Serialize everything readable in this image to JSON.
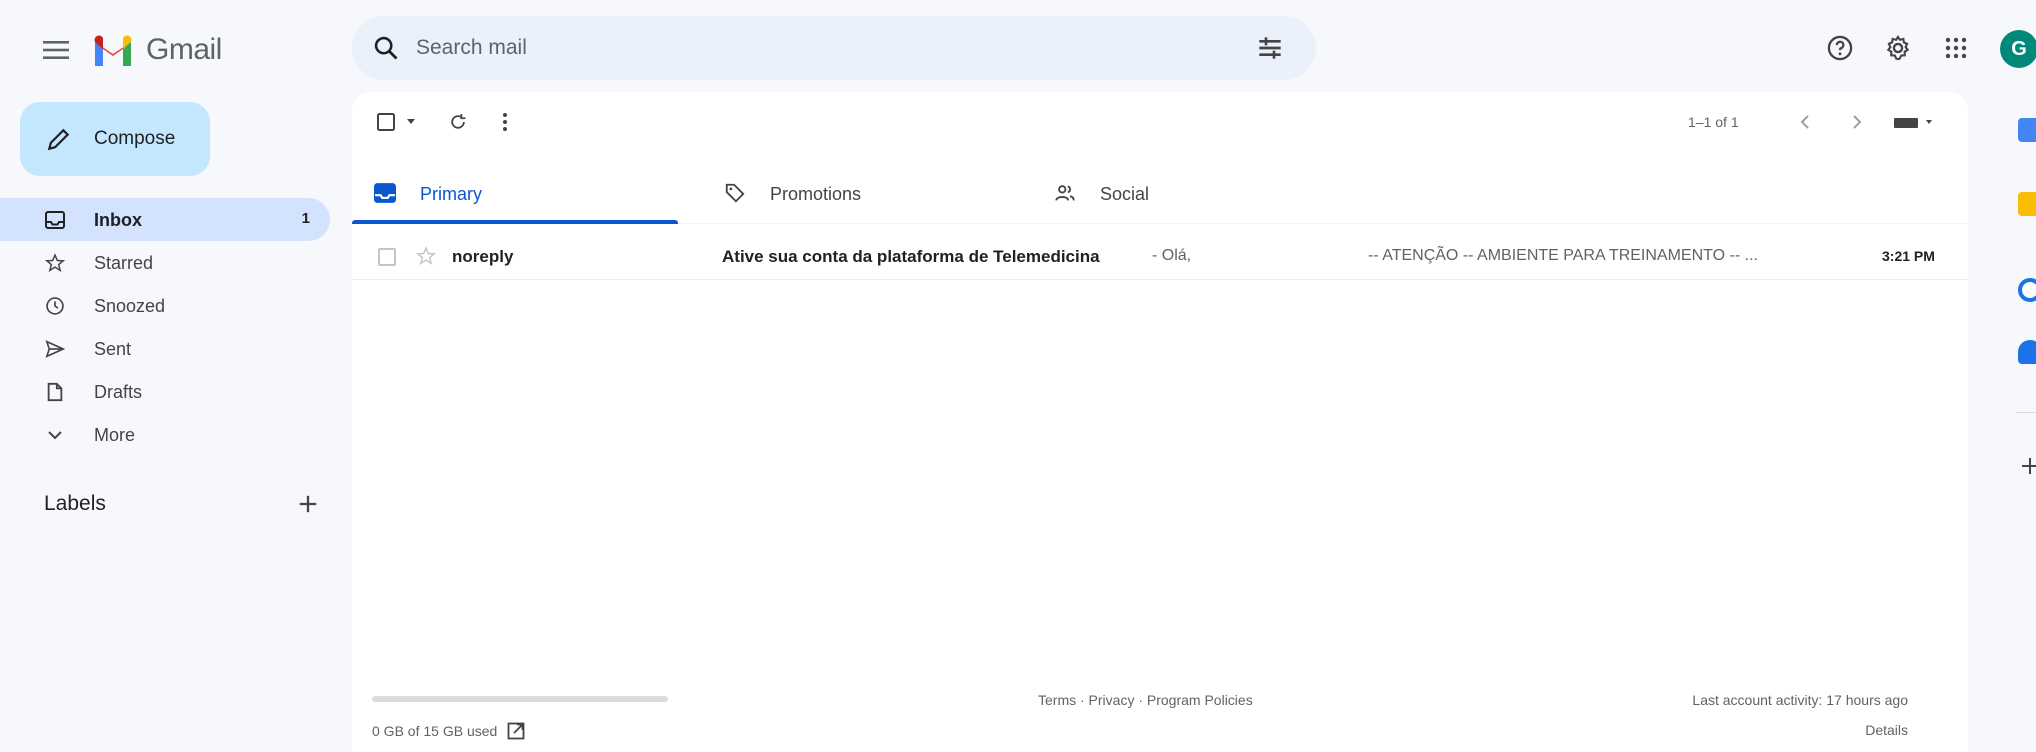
{
  "header": {
    "app_name": "Gmail",
    "search_placeholder": "Search mail",
    "avatar_initial": "G"
  },
  "sidebar": {
    "compose_label": "Compose",
    "items": [
      {
        "label": "Inbox",
        "count": "1",
        "icon": "inbox-icon",
        "active": true
      },
      {
        "label": "Starred",
        "count": "",
        "icon": "star-icon"
      },
      {
        "label": "Snoozed",
        "count": "",
        "icon": "clock-icon"
      },
      {
        "label": "Sent",
        "count": "",
        "icon": "send-icon"
      },
      {
        "label": "Drafts",
        "count": "",
        "icon": "draft-icon"
      },
      {
        "label": "More",
        "count": "",
        "icon": "chevron-down-icon"
      }
    ],
    "labels_title": "Labels"
  },
  "toolbar": {
    "pagination": "1–1 of 1"
  },
  "tabs": [
    {
      "label": "Primary",
      "icon": "inbox-icon",
      "active": true
    },
    {
      "label": "Promotions",
      "icon": "tag-icon"
    },
    {
      "label": "Social",
      "icon": "people-icon"
    }
  ],
  "messages": [
    {
      "sender": "noreply",
      "subject": "Ative sua conta da plataforma de Telemedicina",
      "snippet": "- Olá,",
      "preview": "-- ATENÇÃO -- AMBIENTE PARA TREINAMENTO -- ...",
      "time": "3:21 PM"
    }
  ],
  "footer": {
    "storage": "0 GB of 15 GB used",
    "links": "Terms · Privacy · Program Policies",
    "activity": "Last account activity: 17 hours ago",
    "details": "Details"
  },
  "colors": {
    "accent": "#0b57d0",
    "compose_bg": "#c2e7ff",
    "active_nav_bg": "#d3e3fd",
    "avatar_bg": "#00897b"
  }
}
